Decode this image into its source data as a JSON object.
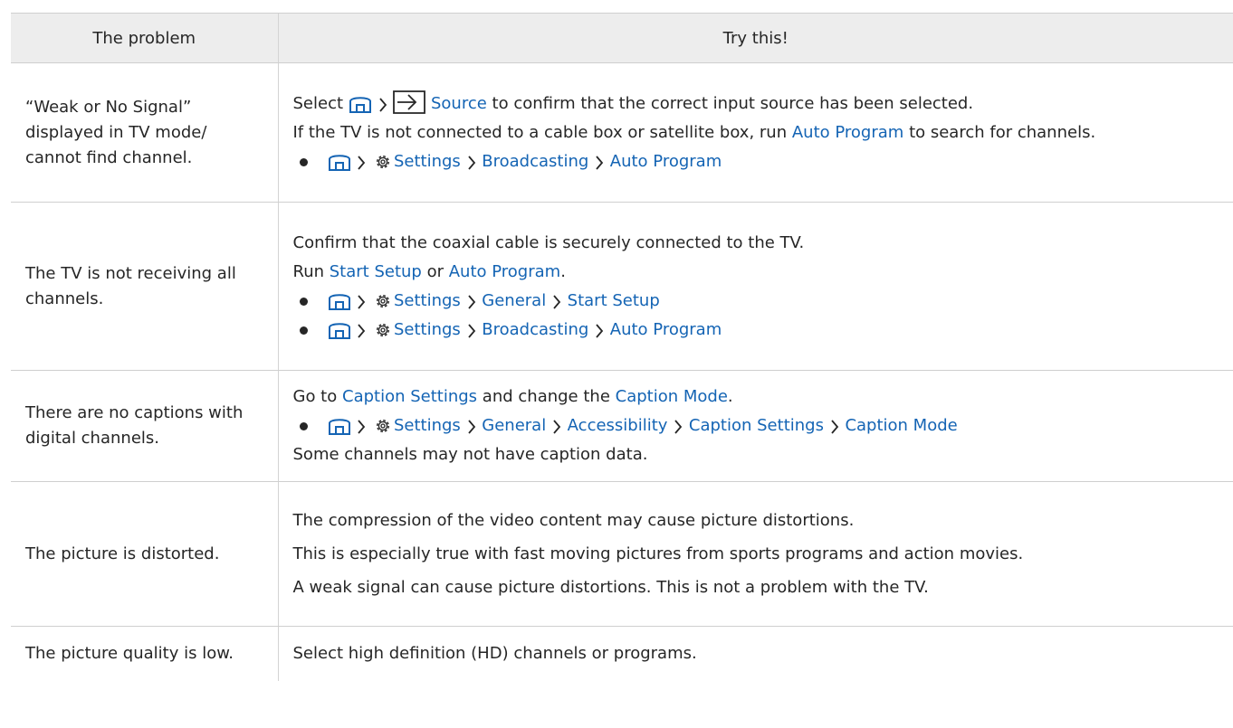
{
  "headers": {
    "problem": "The problem",
    "solution": "Try this!"
  },
  "rows": [
    {
      "problem": "“Weak or No Signal” displayed in TV mode/ cannot find channel.",
      "p1": {
        "a": "Select",
        "link": "Source",
        "b": "to confirm that the correct input source has been selected."
      },
      "p2": {
        "a": "If the TV is not connected to a cable box or satellite box, run",
        "link": "Auto Program",
        "b": "to search for channels."
      },
      "b1": [
        "Settings",
        "Broadcasting",
        "Auto Program"
      ]
    },
    {
      "problem": "The TV is not receiving all channels.",
      "p1": "Confirm that the coaxial cable is securely connected to the TV.",
      "p2": {
        "a": "Run",
        "link1": "Start Setup",
        "or": "or",
        "link2": "Auto Program",
        "dot": "."
      },
      "b1": [
        "Settings",
        "General",
        "Start Setup"
      ],
      "b2": [
        "Settings",
        "Broadcasting",
        "Auto Program"
      ]
    },
    {
      "problem": "There are no captions with digital channels.",
      "p1": {
        "a": "Go to",
        "link1": "Caption Settings",
        "and": "and change the",
        "link2": "Caption Mode",
        "dot": "."
      },
      "b1": [
        "Settings",
        "General",
        "Accessibility",
        "Caption Settings",
        "Caption Mode"
      ],
      "p2": "Some channels may not have caption data."
    },
    {
      "problem": "The picture is distorted.",
      "lines": [
        "The compression of the video content may cause picture distortions.",
        "This is especially true with fast moving pictures from sports programs and action movies.",
        "A weak signal can cause picture distortions. This is not a problem with the TV."
      ]
    },
    {
      "problem": "The picture quality is low.",
      "lines": [
        "Select high definition (HD) channels or programs."
      ]
    }
  ],
  "colors": {
    "link": "#1464b4",
    "text": "#262626",
    "header_bg": "#ededed",
    "grid": "#cfcfcf"
  }
}
